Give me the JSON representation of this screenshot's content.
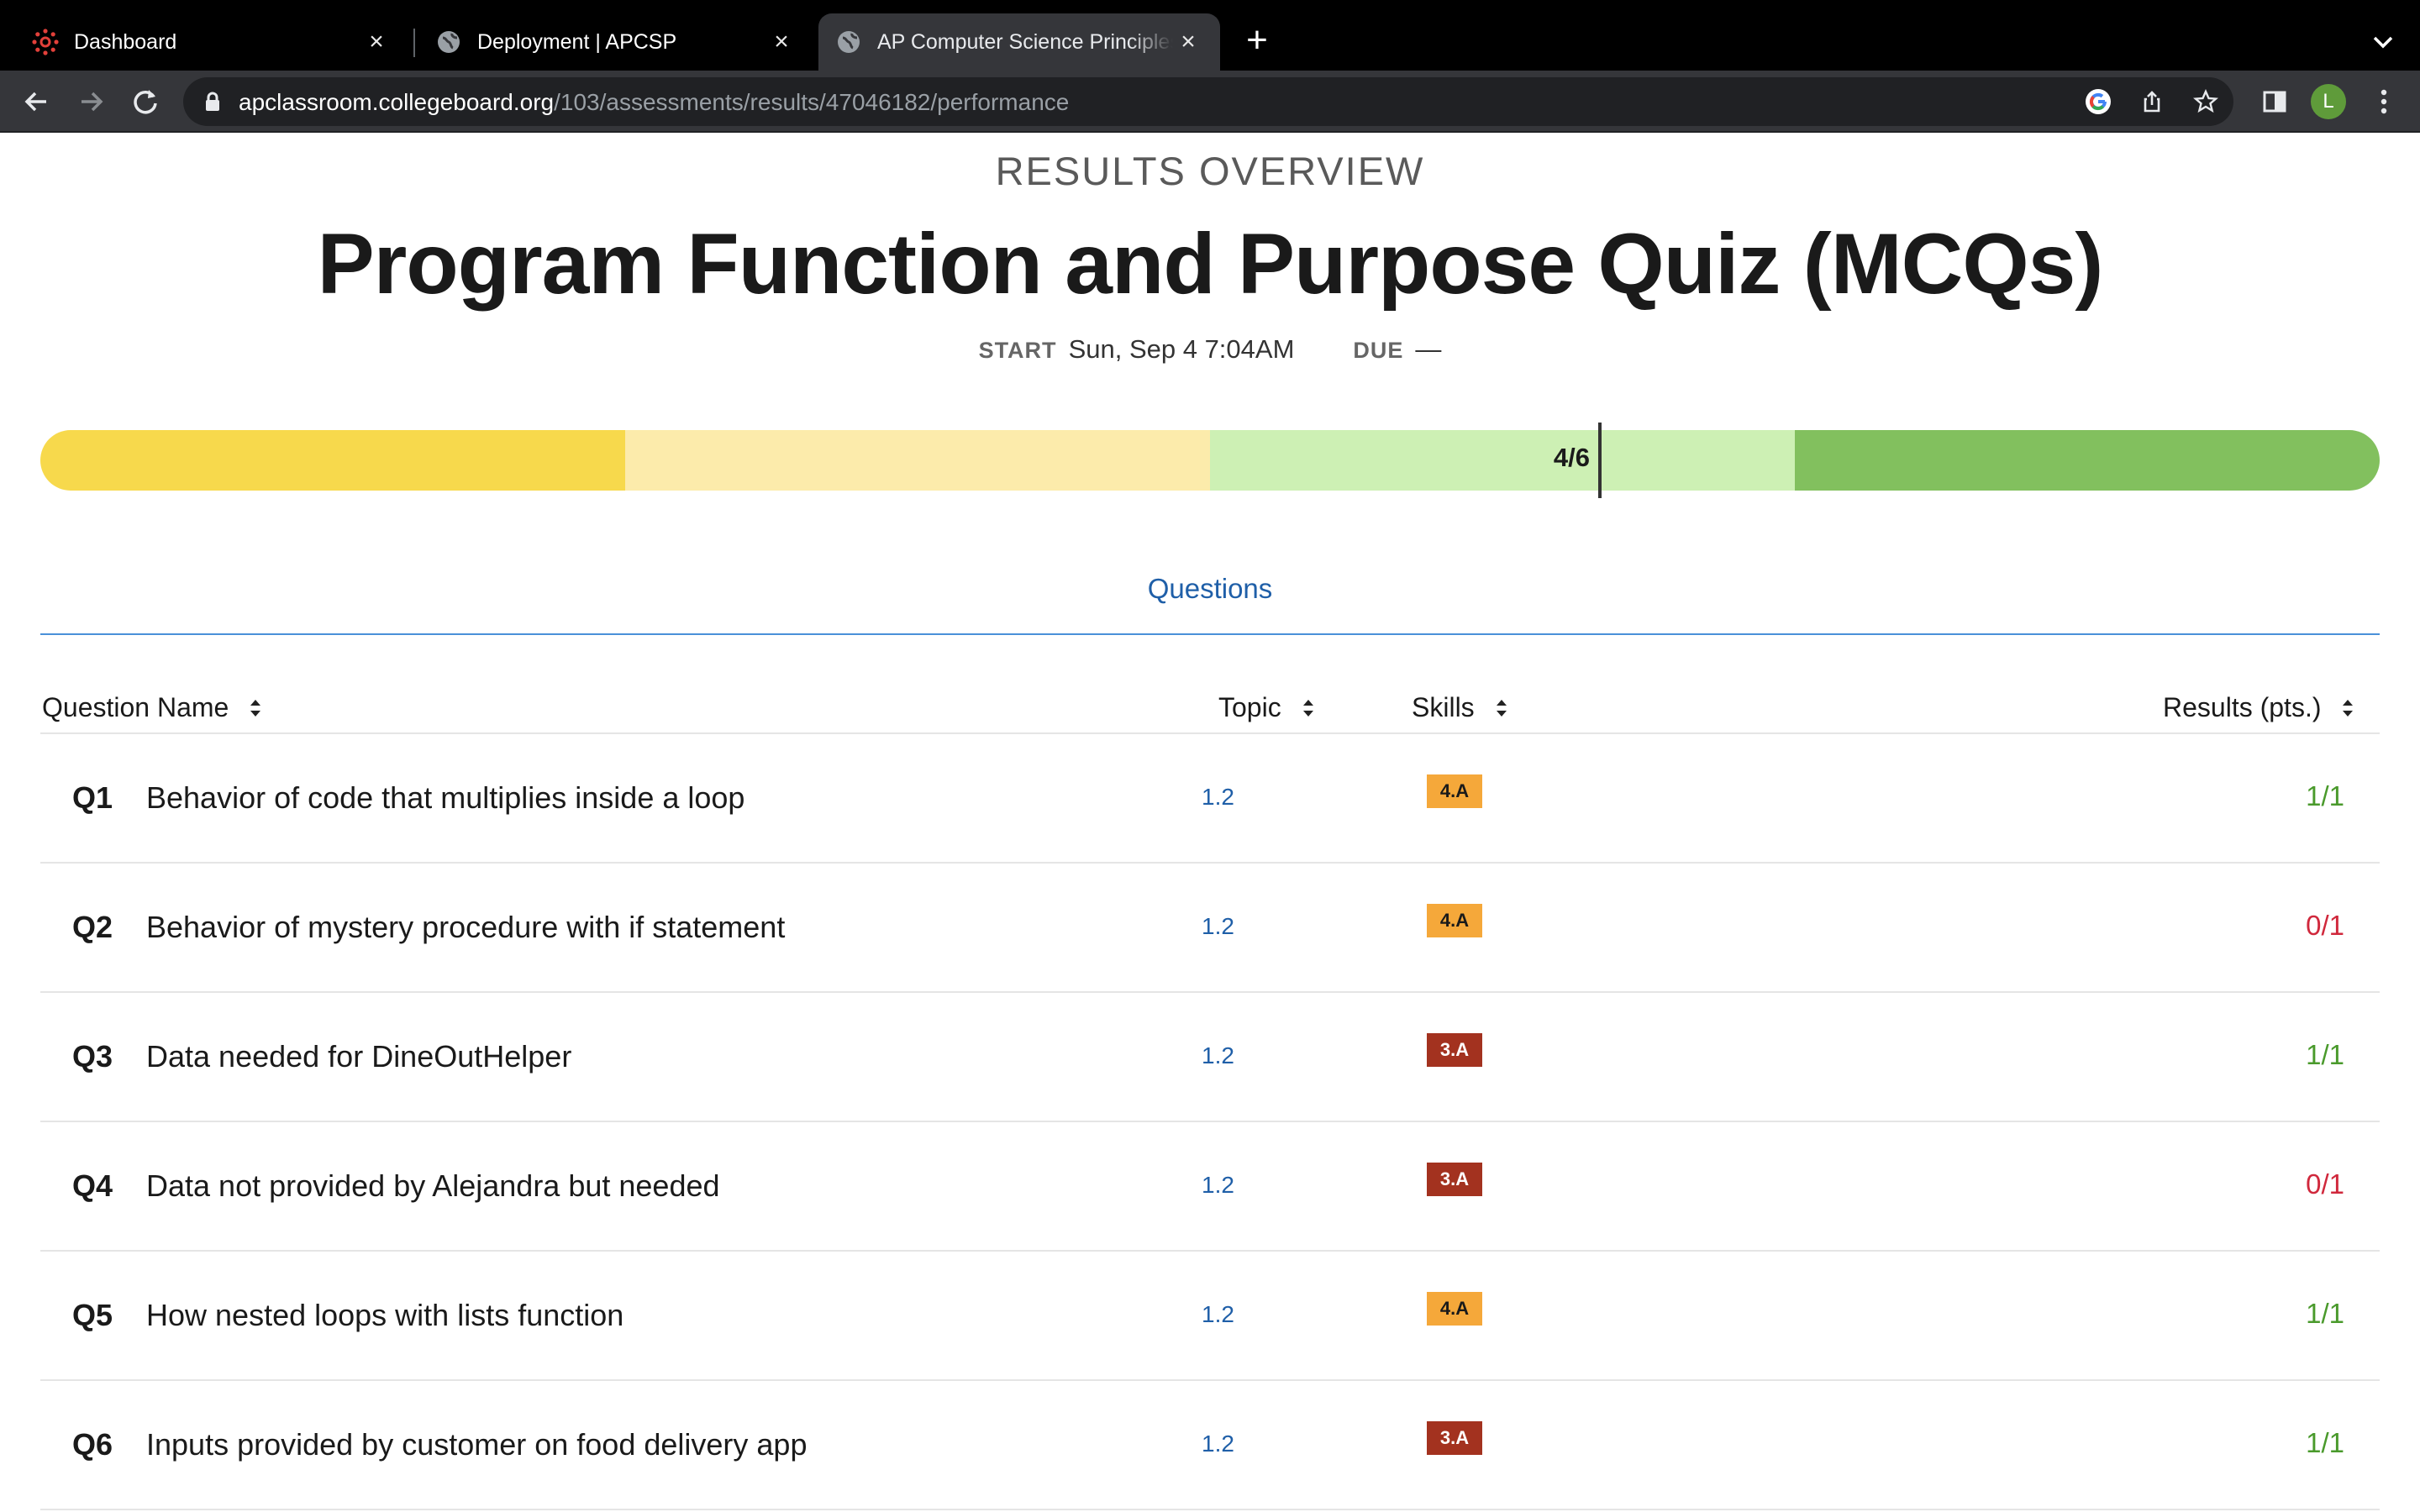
{
  "browser": {
    "tabs": [
      {
        "title": "Dashboard",
        "favicon": "canvas-logo-icon"
      },
      {
        "title": "Deployment | APCSP",
        "favicon": "globe-icon"
      },
      {
        "title": "AP Computer Science Principles",
        "favicon": "globe-icon",
        "active": true
      }
    ],
    "url_host": "apclassroom.collegeboard.org",
    "url_path": "/103/assessments/results/47046182/performance",
    "profile_initial": "L"
  },
  "page": {
    "overline": "RESULTS OVERVIEW",
    "title": "Program Function and Purpose Quiz (MCQs)",
    "start_label": "START",
    "start_value": "Sun, Sep 4 7:04AM",
    "due_label": "DUE",
    "due_value": "—"
  },
  "score": {
    "label": "4/6",
    "earned": 4,
    "total": 6,
    "band_colors": [
      "#f7d94c",
      "#fcebab",
      "#cdf0b4",
      "#82c05e"
    ]
  },
  "section_tab": "Questions",
  "table": {
    "headers": {
      "name": "Question Name",
      "topic": "Topic",
      "skills": "Skills",
      "results": "Results (pts.)"
    },
    "rows": [
      {
        "num": "Q1",
        "name": "Behavior of code that multiplies inside a loop",
        "topic": "1.2",
        "skill": "4.A",
        "result": "1/1"
      },
      {
        "num": "Q2",
        "name": "Behavior of mystery procedure with if statement",
        "topic": "1.2",
        "skill": "4.A",
        "result": "0/1"
      },
      {
        "num": "Q3",
        "name": "Data needed for DineOutHelper",
        "topic": "1.2",
        "skill": "3.A",
        "result": "1/1"
      },
      {
        "num": "Q4",
        "name": "Data not provided by Alejandra but needed",
        "topic": "1.2",
        "skill": "3.A",
        "result": "0/1"
      },
      {
        "num": "Q5",
        "name": "How nested loops with lists function",
        "topic": "1.2",
        "skill": "4.A",
        "result": "1/1"
      },
      {
        "num": "Q6",
        "name": "Inputs provided by customer on food delivery app",
        "topic": "1.2",
        "skill": "3.A",
        "result": "1/1"
      }
    ]
  },
  "colors": {
    "skill_4A_bg": "#f5a83a",
    "skill_4A_text": "#1a1a1a",
    "skill_3A_bg": "#a3321f",
    "skill_3A_text": "#ffffff",
    "correct": "#4a9a2c",
    "incorrect": "#d0283c",
    "link": "#1f5fa8"
  }
}
